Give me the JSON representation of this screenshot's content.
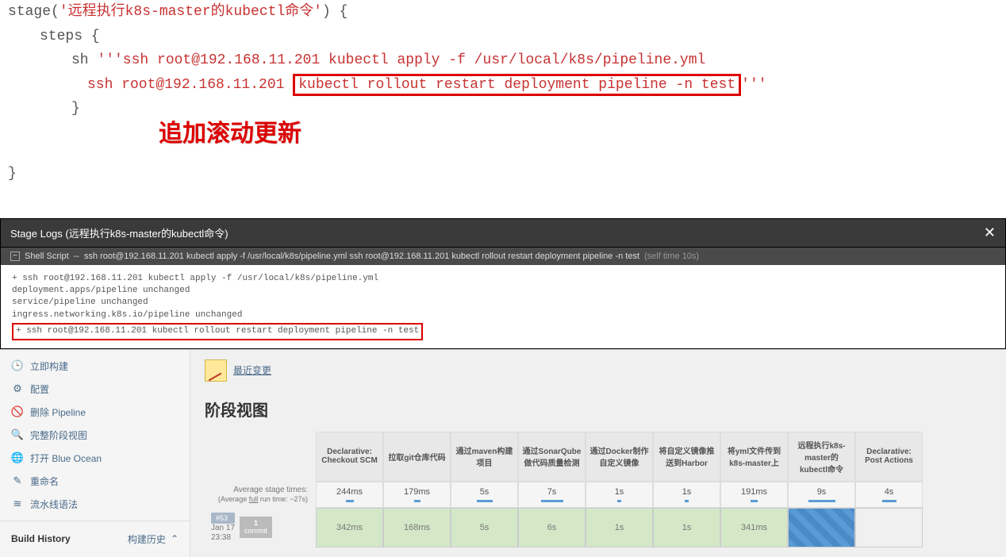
{
  "code": {
    "line1_pre": "stage(",
    "line1_str": "'远程执行k8s-master的kubectl命令'",
    "line1_post": ") {",
    "line2": "steps {",
    "line3_pre": "sh ",
    "line3_str": "'''ssh root@192.168.11.201 kubectl apply -f /usr/local/k8s/pipeline.yml",
    "line4_pre": "ssh root@192.168.11.201 ",
    "line4_box": "kubectl rollout restart deployment pipeline -n test",
    "line4_post": "'''",
    "line5": "}",
    "line6": "}",
    "annotation": "追加滚动更新"
  },
  "logs_header": {
    "title": "Stage Logs (远程执行k8s-master的kubectl命令)"
  },
  "shell_bar": {
    "label": "Shell Script",
    "sep": "--",
    "cmd": "ssh root@192.168.11.201 kubectl apply -f /usr/local/k8s/pipeline.yml ssh root@192.168.11.201 kubectl rollout restart deployment pipeline -n test",
    "self_time": "(self time 10s)"
  },
  "console": {
    "l1": "+ ssh root@192.168.11.201 kubectl apply -f /usr/local/k8s/pipeline.yml",
    "l2": "deployment.apps/pipeline unchanged",
    "l3": "service/pipeline unchanged",
    "l4": "ingress.networking.k8s.io/pipeline unchanged",
    "l5": "+ ssh root@192.168.11.201 kubectl rollout restart deployment pipeline -n test"
  },
  "sidebar": {
    "items": [
      {
        "icon": "🕒",
        "icon_name": "clock-icon",
        "label": "立即构建"
      },
      {
        "icon": "⚙",
        "icon_name": "gear-icon",
        "label": "配置"
      },
      {
        "icon": "🚫",
        "icon_name": "delete-icon",
        "label": "删除 Pipeline"
      },
      {
        "icon": "🔍",
        "icon_name": "search-icon",
        "label": "完整阶段视图"
      },
      {
        "icon": "🌐",
        "icon_name": "blueocean-icon",
        "label": "打开 Blue Ocean"
      },
      {
        "icon": "✎",
        "icon_name": "rename-icon",
        "label": "重命名"
      },
      {
        "icon": "≋",
        "icon_name": "syntax-icon",
        "label": "流水线语法"
      }
    ],
    "build_history": {
      "title": "Build History",
      "label": "构建历史",
      "caret": "⌃"
    }
  },
  "main": {
    "recent_changes": "最近变更",
    "stage_view_title": "阶段视图",
    "stages": [
      "Declarative: Checkout SCM",
      "拉取git仓库代码",
      "通过maven构建项目",
      "通过SonarQube做代码质量检测",
      "通过Docker制作自定义镜像",
      "将自定义镜像推送到Harbor",
      "将yml文件传到k8s-master上",
      "远程执行k8s-master的kubectl命令",
      "Declarative: Post Actions"
    ],
    "avg_label": "Average stage times:",
    "avg_sub_pre": "(Average ",
    "avg_sub_u": "full",
    "avg_sub_post": " run time: ~27s)",
    "avg_times": [
      "244ms",
      "179ms",
      "5s",
      "7s",
      "1s",
      "1s",
      "191ms",
      "9s",
      "4s"
    ],
    "avg_bars": [
      10,
      8,
      20,
      28,
      5,
      5,
      9,
      34,
      18
    ],
    "build": {
      "badge": "#53",
      "date": "Jan 17",
      "time": "23:38",
      "commit_num": "1",
      "commit_label": "commit",
      "times": [
        "342ms",
        "168ms",
        "5s",
        "6s",
        "1s",
        "1s",
        "341ms",
        "",
        ""
      ],
      "classes": [
        "cell-green",
        "cell-green",
        "cell-green",
        "cell-green",
        "cell-green",
        "cell-green",
        "cell-green",
        "cell-running",
        ""
      ]
    }
  }
}
